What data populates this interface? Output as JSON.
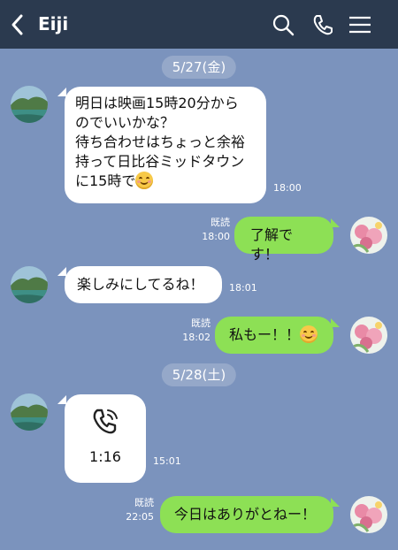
{
  "header": {
    "title": "Eiji"
  },
  "messages": [
    {
      "date": "5/27(金)"
    },
    {
      "lines": [
        "明日は映画15時20分から",
        "のでいいかな？",
        "待ち合わせはちょっと余裕",
        "持って日比谷ミッドタウン",
        "に15時で"
      ],
      "time": "18:00",
      "emoji_end": "smile"
    },
    {
      "text": "了解です！",
      "read": "既読",
      "time": "18:00"
    },
    {
      "text": "楽しみにしてるね！",
      "time": "18:01"
    },
    {
      "text": "私もー！！",
      "read": "既読",
      "time": "18:02",
      "emoji_end": "smile"
    },
    {
      "date": "5/28(土)"
    },
    {
      "call_duration": "1:16",
      "time": "15:01"
    },
    {
      "text": "今日はありがとねー！",
      "read": "既読",
      "time": "22:05"
    }
  ],
  "colors": {
    "header_bg": "#2b3a4f",
    "chat_bg": "#7b93bd",
    "bubble_in": "#ffffff",
    "bubble_out": "#8de055",
    "date_pill": "#95a8c9"
  },
  "icons": {
    "back": "chevron-left-icon",
    "search": "search-icon",
    "call": "phone-icon",
    "menu": "hamburger-menu-icon",
    "call_message": "phone-call-icon"
  }
}
